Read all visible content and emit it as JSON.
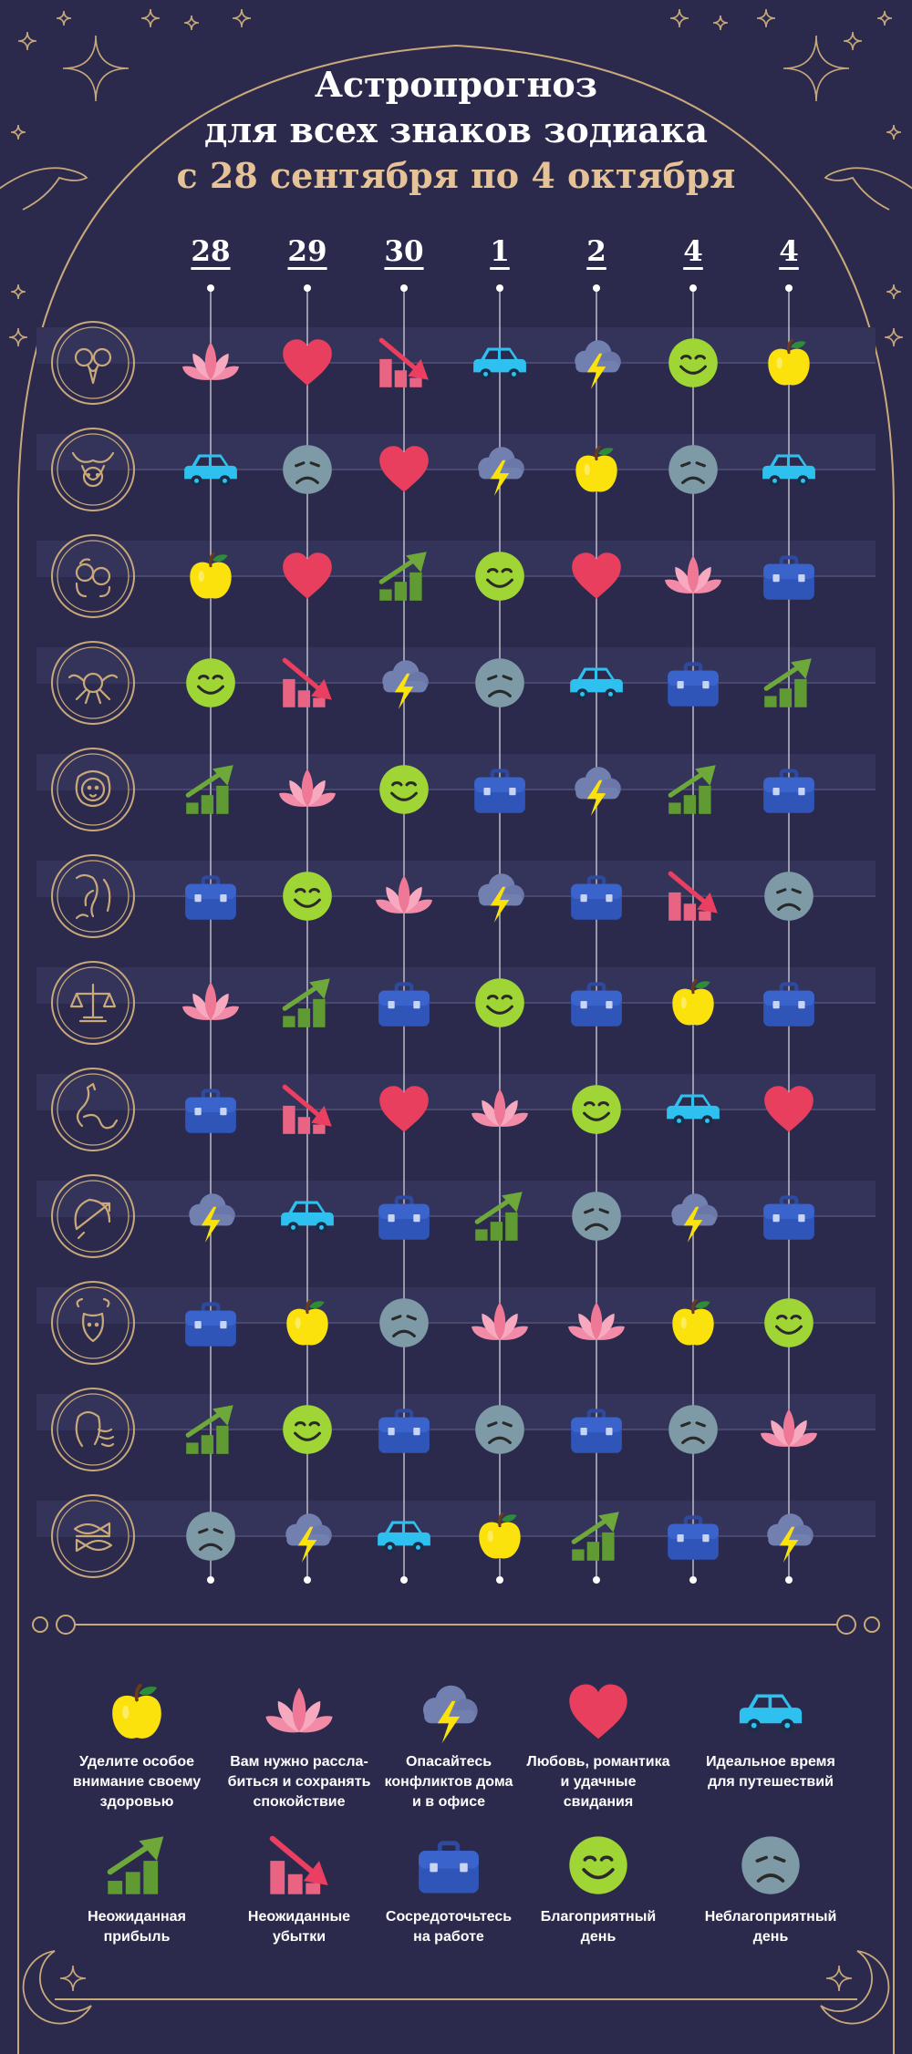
{
  "header": {
    "title_line1": "Астропрогноз",
    "title_line2": "для всех знаков зодиака",
    "title_line3": "с 28 сентября по 4 октября"
  },
  "days": [
    "28",
    "29",
    "30",
    "1",
    "2",
    "4",
    "4"
  ],
  "signs": [
    "aries",
    "taurus",
    "gemini",
    "cancer",
    "leo",
    "virgo",
    "libra",
    "scorpio",
    "sagittarius",
    "capricorn",
    "aquarius",
    "pisces"
  ],
  "grid": [
    [
      "lotus",
      "heart",
      "loss",
      "car",
      "storm",
      "happy",
      "apple"
    ],
    [
      "car",
      "sad",
      "heart",
      "storm",
      "apple",
      "sad",
      "car"
    ],
    [
      "apple",
      "heart",
      "profit",
      "happy",
      "heart",
      "lotus",
      "briefcase"
    ],
    [
      "happy",
      "loss",
      "storm",
      "sad",
      "car",
      "briefcase",
      "profit"
    ],
    [
      "profit",
      "lotus",
      "happy",
      "briefcase",
      "storm",
      "profit",
      "briefcase"
    ],
    [
      "briefcase",
      "happy",
      "lotus",
      "storm",
      "briefcase",
      "loss",
      "sad"
    ],
    [
      "lotus",
      "profit",
      "briefcase",
      "happy",
      "briefcase",
      "apple",
      "briefcase"
    ],
    [
      "briefcase",
      "loss",
      "heart",
      "lotus",
      "happy",
      "car",
      "heart"
    ],
    [
      "storm",
      "car",
      "briefcase",
      "profit",
      "sad",
      "storm",
      "briefcase"
    ],
    [
      "briefcase",
      "apple",
      "sad",
      "lotus",
      "lotus",
      "apple",
      "happy"
    ],
    [
      "profit",
      "happy",
      "briefcase",
      "sad",
      "briefcase",
      "sad",
      "lotus"
    ],
    [
      "sad",
      "storm",
      "car",
      "apple",
      "profit",
      "briefcase",
      "storm"
    ]
  ],
  "legend": [
    {
      "icon": "apple",
      "label": "Уделите особое\nвнимание своему\nздоровью"
    },
    {
      "icon": "lotus",
      "label": "Вам нужно рассла-\nбиться и сохранять\nспокойствие"
    },
    {
      "icon": "storm",
      "label": "Опасайтесь\nконфликтов дома\nи в офисе"
    },
    {
      "icon": "heart",
      "label": "Любовь, романтика\nи удачные\nсвидания"
    },
    {
      "icon": "car",
      "label": "Идеальное время\nдля путешествий"
    },
    {
      "icon": "profit",
      "label": "Неожиданная\nприбыль"
    },
    {
      "icon": "loss",
      "label": "Неожиданные\nубытки"
    },
    {
      "icon": "briefcase",
      "label": "Сосредоточьтесь\nна работе"
    },
    {
      "icon": "happy",
      "label": "Благоприятный\nдень"
    },
    {
      "icon": "sad",
      "label": "Неблагоприятный\nдень"
    }
  ],
  "colors": {
    "background": "#2b2a4d",
    "stripe": "#34335a",
    "gold": "#c9a97a",
    "title_accent": "#e6c396"
  }
}
